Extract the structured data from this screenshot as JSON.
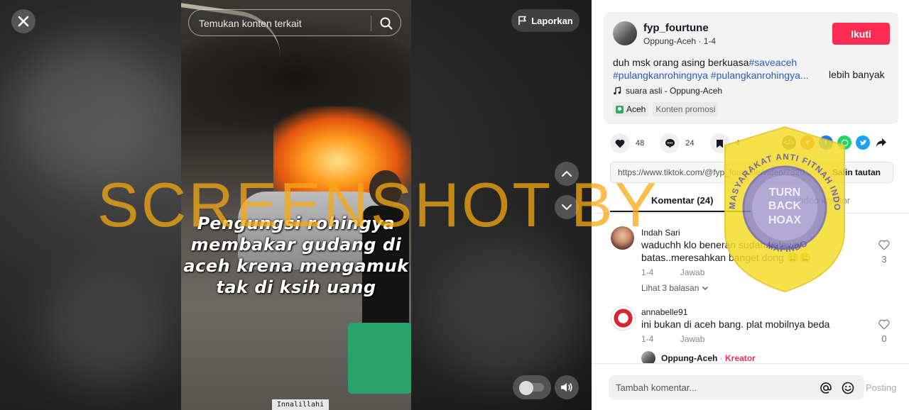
{
  "video": {
    "search_placeholder": "Temukan konten terkait",
    "report_label": "Laporkan",
    "caption_lines": [
      "Pengungsi rohingya",
      "membakar gudang di",
      "aceh krena mengamuk",
      "tak di ksih uang"
    ],
    "frame_footer": "Innalillahi"
  },
  "watermark": {
    "text": "SCREENSHOT BY",
    "color": "#f5aa14"
  },
  "seal": {
    "top_text": "MASYARAKAT ANTI FITNAH INDONESIA",
    "bottom_text": "MAFINDO",
    "center_text": [
      "TURN",
      "BACK",
      "HOAX"
    ]
  },
  "author": {
    "username": "fyp_fourtune",
    "subline": "Oppung-Aceh · 1-4",
    "follow_label": "Ikuti",
    "desc_prefix": "duh msk orang asing berkuasa",
    "hashtags": [
      "#saveaceh",
      "#pulangkanrohingnya",
      "#pulangkanrohingya..."
    ],
    "more_label": "lebih banyak",
    "music": "suara asli - Oppung-Aceh",
    "location_tag": "Aceh",
    "promo_tag": "Konten promosi"
  },
  "stats": {
    "likes": "48",
    "comments": "24",
    "saves": "4"
  },
  "share": {
    "link": "https://www.tiktok.com/@fyp_fourtune/video/7320...",
    "copy_label": "Salin tautan"
  },
  "tabs": {
    "comments": "Komentar (24)",
    "creator_videos": "Video kreator"
  },
  "comments": [
    {
      "name": "Indah Sari",
      "text": "waduchh klo beneran sudah kelewat batas..meresahkan banget dong",
      "emoji": "😩😩",
      "date": "1-4",
      "reply_label": "Jawab",
      "likes": "3",
      "more_replies": "Lihat 3 balasan"
    },
    {
      "name": "annabelle91",
      "text": "ini bukan di aceh bang. plat mobilnya beda",
      "date": "1-4",
      "reply_label": "Jawab",
      "likes": "0"
    }
  ],
  "creator_reply": {
    "name": "Oppung-Aceh",
    "badge": "Kreator"
  },
  "composer": {
    "placeholder": "Tambah komentar...",
    "post_label": "Posting"
  },
  "colors": {
    "accent": "#fe2c55",
    "hashtag": "#2b5db9"
  }
}
